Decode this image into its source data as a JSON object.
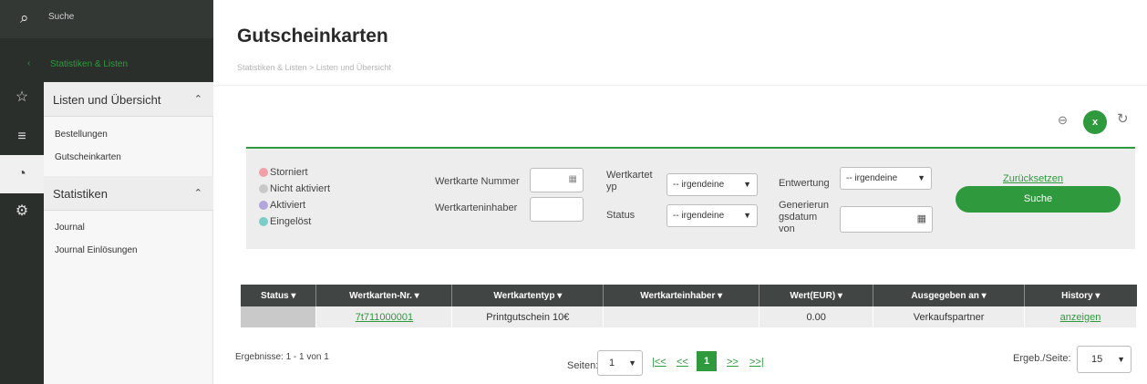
{
  "topbar": {
    "search_placeholder": "Suche",
    "back_label": "Statistiken & Listen"
  },
  "sidebar": {
    "sections": [
      {
        "label": "Listen und Übersicht",
        "items": [
          "Bestellungen",
          "Gutscheinkarten"
        ]
      },
      {
        "label": "Statistiken",
        "items": [
          "Journal",
          "Journal Einlösungen"
        ]
      }
    ]
  },
  "header": {
    "title": "Gutscheinkarten",
    "breadcrumb": "Statistiken & Listen > Listen und Übersicht"
  },
  "toolbar": {
    "zoom_icon": "⊖",
    "excel_icon": "x",
    "refresh_icon": "↻"
  },
  "filter": {
    "legend": [
      {
        "label": "Storniert",
        "color": "#f2a0a8"
      },
      {
        "label": "Nicht aktiviert",
        "color": "#c9c9c9"
      },
      {
        "label": "Aktiviert",
        "color": "#b3a6dd"
      },
      {
        "label": "Eingelöst",
        "color": "#7ccdc8"
      }
    ],
    "card_number_label": "Wertkarte Nummer",
    "card_holder_label": "Wertkarteninhaber",
    "card_type_label_1": "Wertkartet",
    "card_type_label_2": "yp",
    "card_type_value": "-- irgendeine",
    "status_label": "Status",
    "status_value": "-- irgendeine",
    "devaluation_label": "Entwertung",
    "devaluation_value": "-- irgendeine",
    "gen_date_label_1": "Generierun",
    "gen_date_label_2": "gsdatum",
    "gen_date_label_3": "von",
    "reset_label": "Zurücksetzen",
    "search_label": "Suche"
  },
  "table": {
    "headers": [
      "Status ▾",
      "Wertkarten-Nr. ▾",
      "Wertkartentyp ▾",
      "Wertkarteinhaber ▾",
      "Wert(EUR) ▾",
      "Ausgegeben an ▾",
      "History ▾"
    ],
    "rows": [
      {
        "status": "",
        "number": "7t711000001",
        "type": "Printgutschein 10€",
        "holder": "",
        "value": "0.00",
        "issued_to": "Verkaufspartner",
        "history": "anzeigen"
      }
    ]
  },
  "pager": {
    "results": "Ergebnisse: 1 - 1 von 1",
    "pages_label": "Seiten:",
    "page_value": "1",
    "first": "|<<",
    "prev": "<<",
    "current": "1",
    "next": ">>",
    "last": ">>|",
    "per_page_label": "Ergeb./Seite:",
    "per_page_value": "15"
  }
}
